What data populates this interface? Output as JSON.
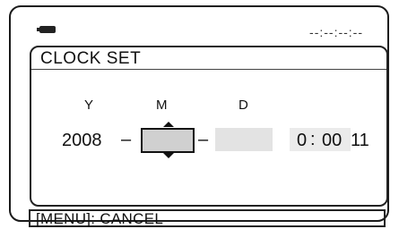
{
  "status": {
    "top_time": "--:--:--:--"
  },
  "screen": {
    "title": "CLOCK SET"
  },
  "fields": {
    "year": {
      "label": "Y",
      "value": "2008"
    },
    "month": {
      "label": "M",
      "value": ""
    },
    "day": {
      "label": "D",
      "value": ""
    },
    "time": {
      "hour": "0",
      "separator": ":",
      "minutes": "00",
      "seconds": "11"
    }
  },
  "separators": {
    "dash": "–"
  },
  "footer": {
    "cancel_label": "[MENU]: CANCEL"
  }
}
